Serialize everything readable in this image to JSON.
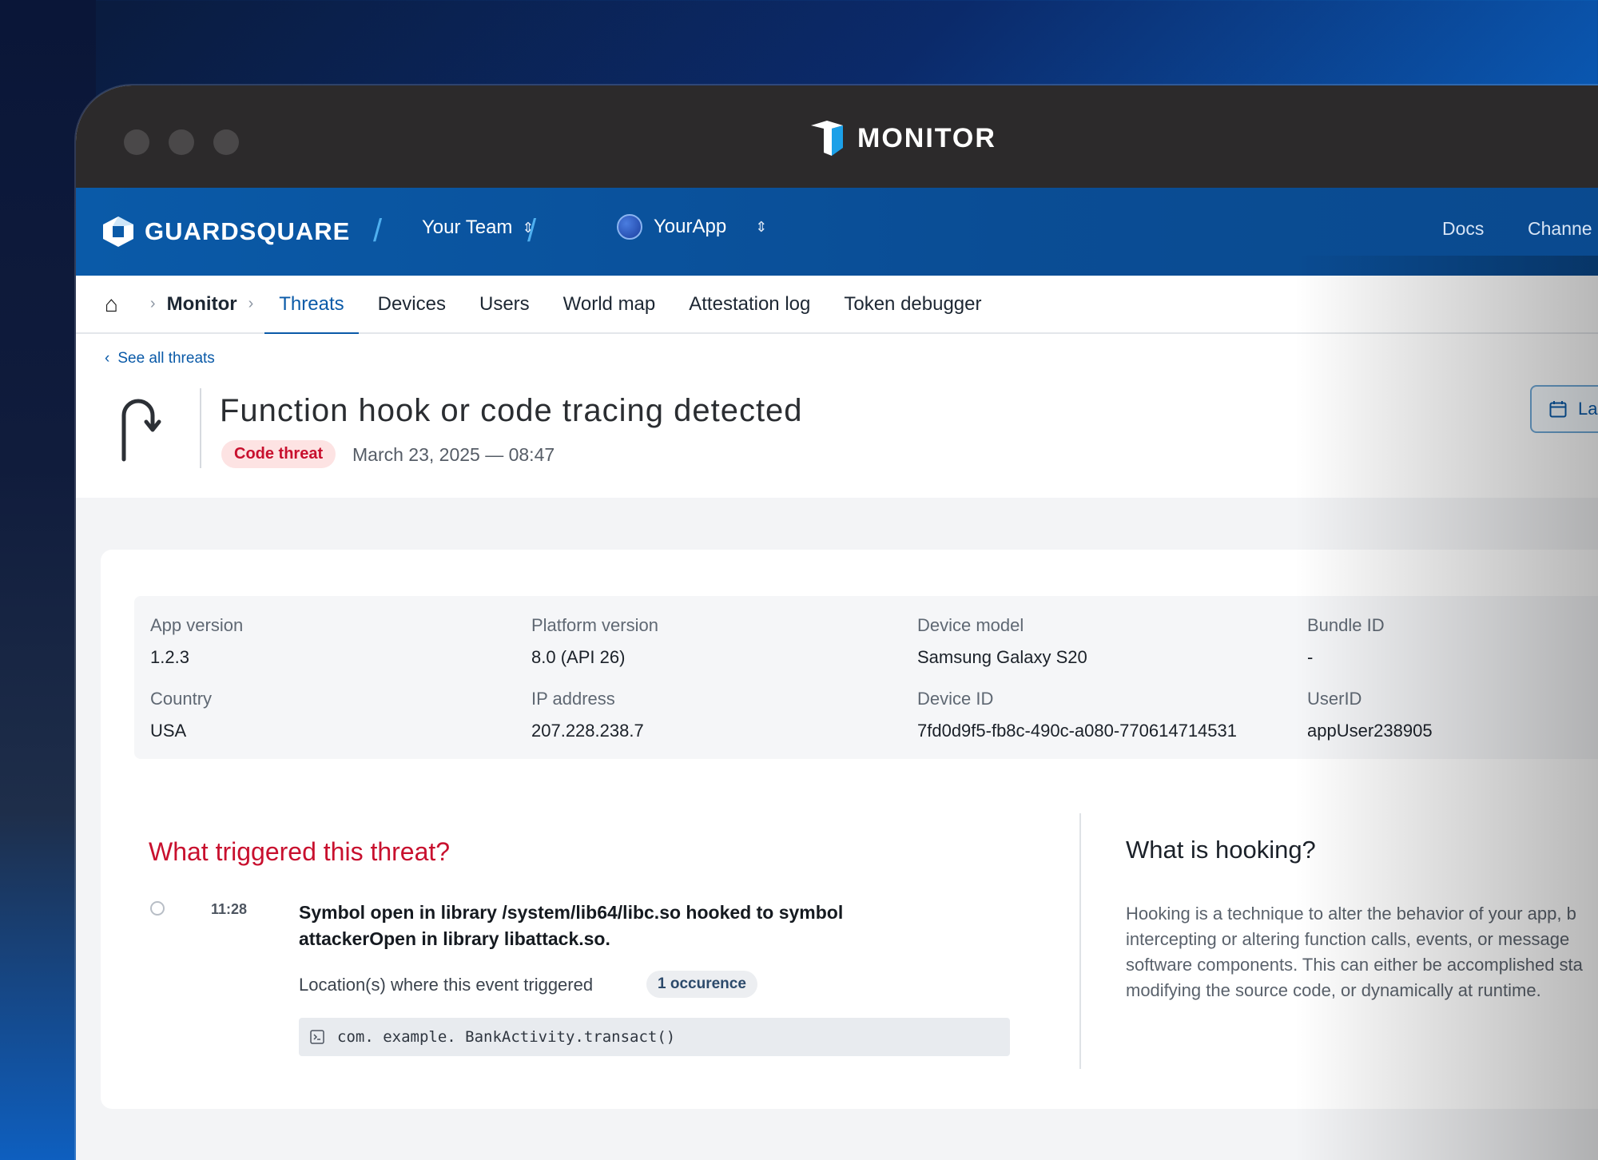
{
  "window": {
    "title": "MONITOR"
  },
  "nav": {
    "brand": "GUARDSQUARE",
    "team": "Your Team",
    "app": "YourApp",
    "docs": "Docs",
    "channel": "Channe"
  },
  "subnav": {
    "monitor": "Monitor",
    "tabs": [
      "Threats",
      "Devices",
      "Users",
      "World map",
      "Attestation log",
      "Token debugger"
    ]
  },
  "header": {
    "back": "See all threats",
    "title": "Function hook or code tracing detected",
    "badge": "Code threat",
    "date": "March 23, 2025 — 08:47",
    "date_button": "La"
  },
  "info": {
    "app_version_label": "App version",
    "app_version": "1.2.3",
    "platform_label": "Platform version",
    "platform": "8.0 (API 26)",
    "device_model_label": "Device model",
    "device_model": "Samsung Galaxy S20",
    "bundle_label": "Bundle ID",
    "bundle": "-",
    "country_label": "Country",
    "country": "USA",
    "ip_label": "IP address",
    "ip": "207.228.238.7",
    "device_id_label": "Device ID",
    "device_id": "7fd0d9f5-fb8c-490c-a080-770614714531",
    "user_id_label": "UserID",
    "user_id": "appUser238905"
  },
  "trigger": {
    "title": "What triggered this threat?",
    "time": "11:28",
    "event": "Symbol open in library /system/lib64/libc.so hooked to symbol attackerOpen in library libattack.so.",
    "location_label": "Location(s) where this event triggered",
    "occurrence": "1 occurence",
    "code": "com. example. BankActivity.transact()"
  },
  "what": {
    "title": "What is hooking?",
    "text": "Hooking is a technique to alter the behavior of your app, b intercepting or altering function calls, events, or message software components. This can either be accomplished sta modifying the source code, or dynamically at runtime."
  },
  "colors": {
    "accent": "#0a5aa8",
    "danger": "#c8102e",
    "titlebar": "#2c2a2b"
  }
}
